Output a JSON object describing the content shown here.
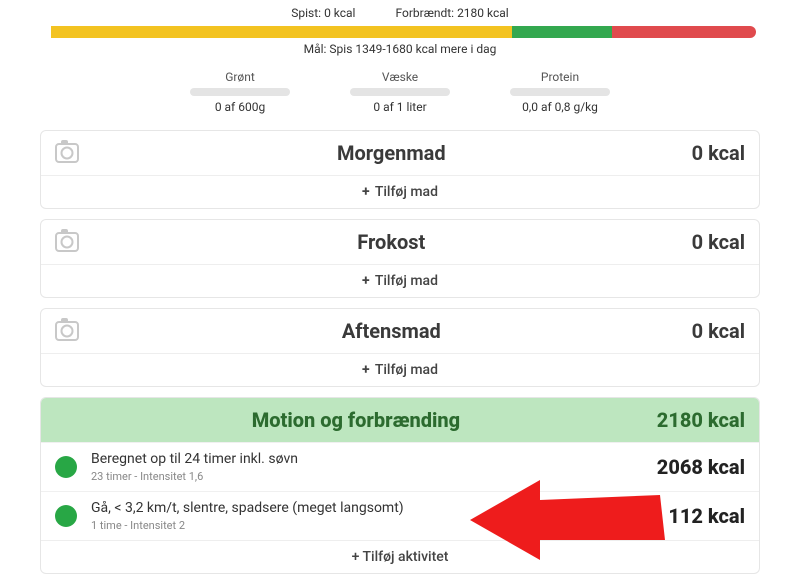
{
  "summary": {
    "eaten_label": "Spist:",
    "eaten_value": "0 kcal",
    "burned_label": "Forbrændt:",
    "burned_value": "2180 kcal",
    "goal_text": "Mål: Spis 1349-1680 kcal mere i dag",
    "bar": {
      "yellow_pct": 64,
      "green_pct": 14,
      "red_pct": 20
    }
  },
  "macros": [
    {
      "label": "Grønt",
      "value": "0 af 600g"
    },
    {
      "label": "Væske",
      "value": "0 af 1 liter"
    },
    {
      "label": "Protein",
      "value": "0,0 af 0,8 g/kg"
    }
  ],
  "meals": [
    {
      "title": "Morgenmad",
      "kcal": "0 kcal",
      "add_label": "Tilføj mad"
    },
    {
      "title": "Frokost",
      "kcal": "0 kcal",
      "add_label": "Tilføj mad"
    },
    {
      "title": "Aftensmad",
      "kcal": "0 kcal",
      "add_label": "Tilføj mad"
    }
  ],
  "exercise": {
    "title": "Motion og forbrænding",
    "total": "2180 kcal",
    "items": [
      {
        "name": "Beregnet op til 24 timer inkl. søvn",
        "sub": "23 timer - Intensitet 1,6",
        "kcal": "2068 kcal"
      },
      {
        "name": "Gå, < 3,2 km/t, slentre, spadsere (meget langsomt)",
        "sub": "1 time - Intensitet 2",
        "kcal": "112 kcal"
      }
    ],
    "add_label": "Tilføj aktivitet"
  },
  "plus": "+"
}
